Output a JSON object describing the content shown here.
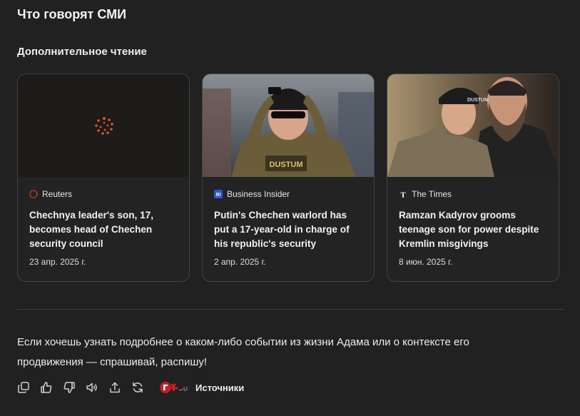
{
  "section_title": "Что говорят СМИ",
  "subsection_title": "Дополнительное чтение",
  "colors": {
    "background": "#212121",
    "card_border": "#444444",
    "reuters_orange": "#e0552b",
    "bi_blue": "#2f55d4"
  },
  "cards": [
    {
      "source": "Reuters",
      "source_icon": "reuters-logo-icon",
      "headline": "Chechnya leader's son, 17, becomes head of Chechen security council",
      "date": "23 апр. 2025 г."
    },
    {
      "source": "Business Insider",
      "source_icon": "business-insider-logo-icon",
      "source_icon_text": "BI",
      "headline": "Putin's Chechen warlord has put a 17-year-old in charge of his republic's security",
      "date": "2 апр. 2025 г.",
      "image_caption": "DUSTUM"
    },
    {
      "source": "The Times",
      "source_icon": "the-times-logo-icon",
      "source_icon_text": "T",
      "headline": "Ramzan Kadyrov grooms teenage son for power despite Kremlin misgivings",
      "date": "8 июн. 2025 г.",
      "image_caption": "DUSTUM"
    }
  ],
  "message": "Если хочешь узнать подробнее о каком-либо событии из жизни Адама или о контексте его продвижения — спрашивай, распишу!",
  "toolbar": {
    "icons": [
      "copy-icon",
      "thumbs-up-icon",
      "thumbs-down-icon",
      "speaker-icon",
      "share-icon",
      "regenerate-icon"
    ],
    "sources_label": "Источники"
  }
}
